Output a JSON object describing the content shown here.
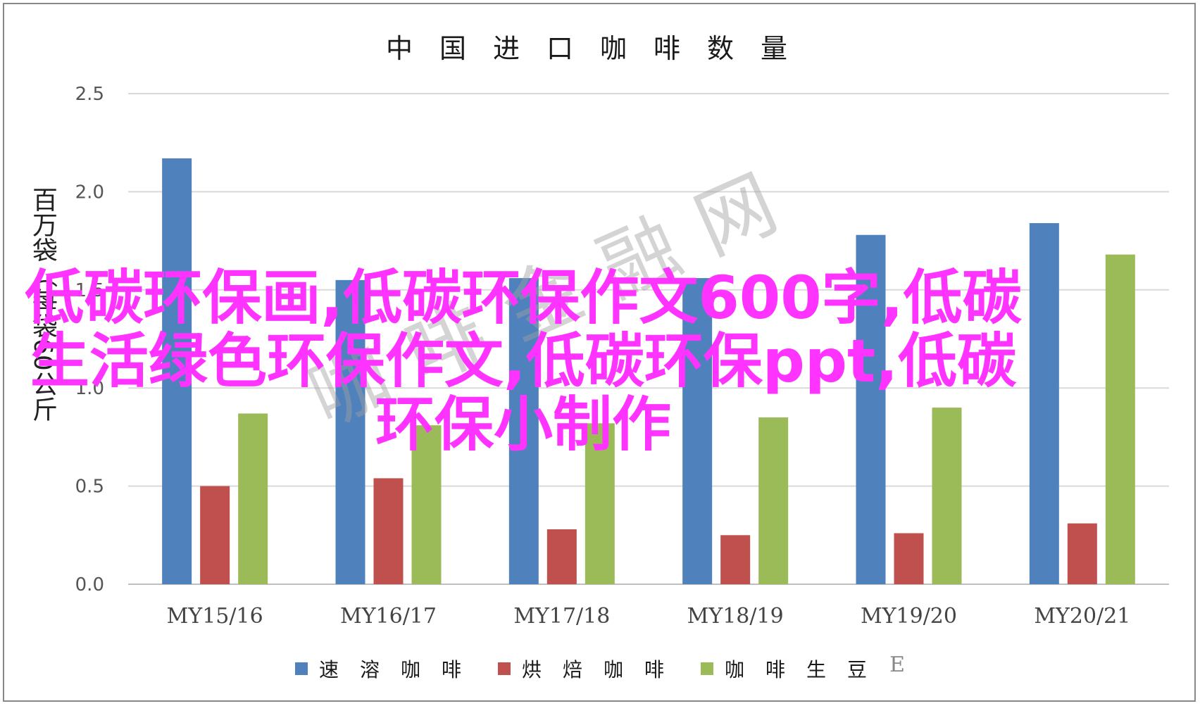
{
  "chart_data": {
    "type": "bar",
    "title": "中国进口咖啡数量",
    "ylabel": "百万袋（每袋60公斤",
    "ylim": [
      0,
      2.5
    ],
    "yticks": [
      "0.0",
      "0.5",
      "1.0",
      "1.5",
      "2.0",
      "2.5"
    ],
    "grid": true,
    "legend_position": "bottom",
    "categories": [
      "MY15/16",
      "MY16/17",
      "MY17/18",
      "MY18/19",
      "MY19/20",
      "MY20/21"
    ],
    "series": [
      {
        "name": "速溶咖啡",
        "color": "#4f81bd",
        "values": [
          2.17,
          1.55,
          1.56,
          1.56,
          1.78,
          1.84
        ]
      },
      {
        "name": "烘焙咖啡",
        "color": "#c0504d",
        "values": [
          0.5,
          0.54,
          0.28,
          0.25,
          0.26,
          0.31
        ]
      },
      {
        "name": "咖啡生豆",
        "color": "#9bbb59",
        "values": [
          0.87,
          0.81,
          0.82,
          0.85,
          0.9,
          1.68
        ]
      }
    ],
    "legend_extra": "E"
  },
  "watermark": "咖啡金融网",
  "overlay_text": "低碳环保画,低碳环保作文600字,低碳生活绿色环保作文,低碳环保ppt,低碳环保小制作"
}
